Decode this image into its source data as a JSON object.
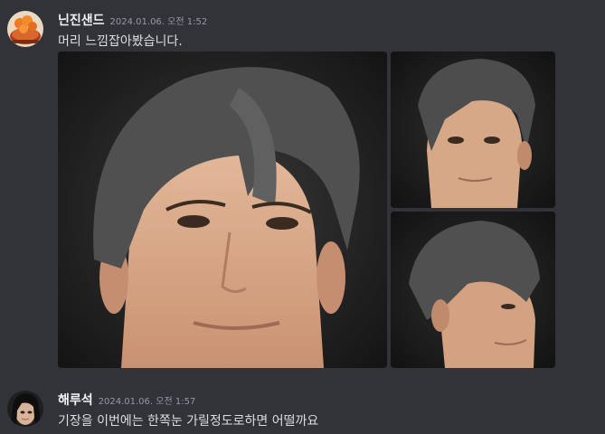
{
  "messages": [
    {
      "username": "닌진샌드",
      "timestamp": "2024.01.06. 오전 1:52",
      "content": "머리 느낌잡아봤습니다.",
      "avatar_icon": "orange-food-avatar-icon",
      "attachments": [
        {
          "icon": "3d-male-head-front-render"
        },
        {
          "icon": "3d-male-head-three-quarter-render"
        },
        {
          "icon": "3d-male-head-side-render"
        }
      ]
    },
    {
      "username": "해루석",
      "timestamp": "2024.01.06. 오전 1:57",
      "content": "기장을 이번에는 한쪽눈 가릴정도로하면 어떨까요",
      "avatar_icon": "dark-hair-character-avatar-icon"
    }
  ],
  "colors": {
    "background": "#313338",
    "username": "#f2f3f5",
    "timestamp": "#949ba4",
    "text": "#dbdee1"
  }
}
